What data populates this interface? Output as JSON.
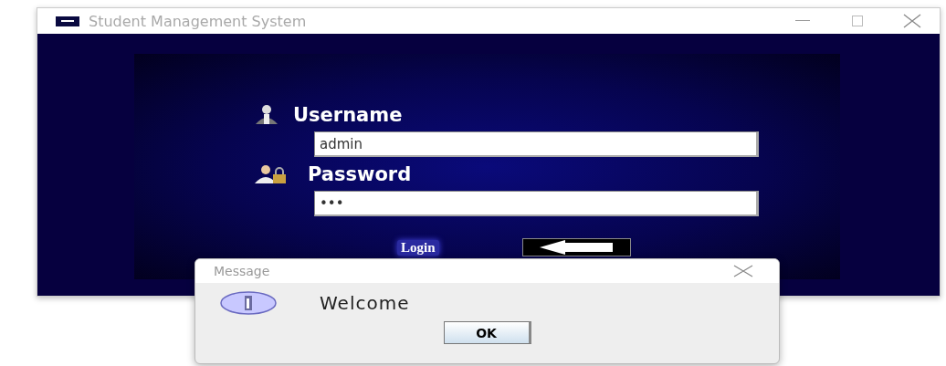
{
  "window": {
    "title": "Student Management System"
  },
  "form": {
    "username": {
      "label": "Username",
      "value": "admin"
    },
    "password": {
      "label": "Password",
      "value": "•••"
    },
    "login_label": "Login"
  },
  "dialog": {
    "title": "Message",
    "message": "Welcome",
    "button": "OK"
  }
}
